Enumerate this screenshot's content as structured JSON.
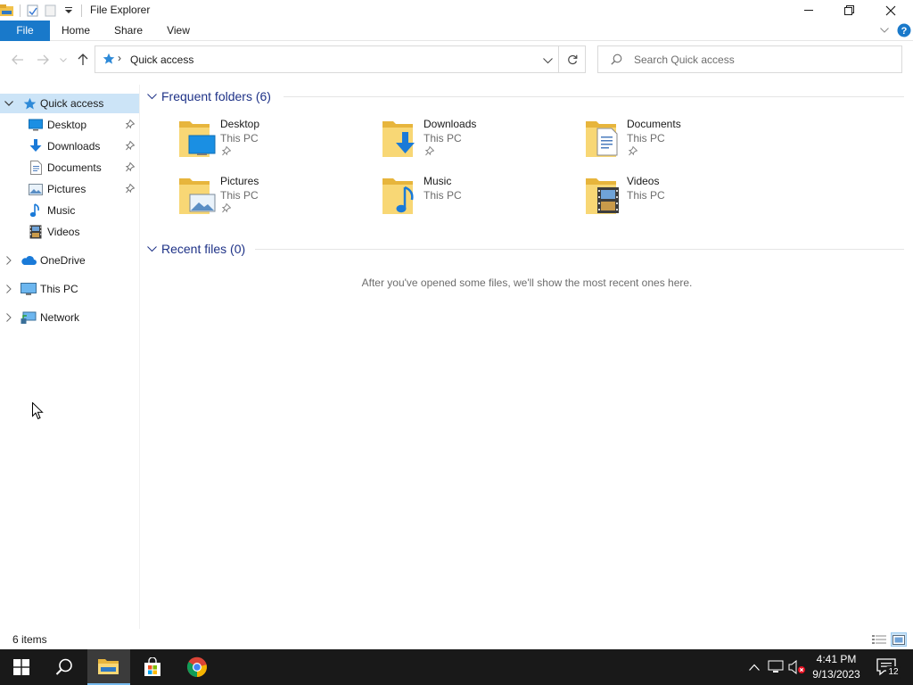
{
  "window": {
    "title": "File Explorer",
    "minimize_icon": "minimize-icon",
    "maximize_icon": "restore-icon",
    "close_icon": "close-icon"
  },
  "ribbon": {
    "tabs": [
      {
        "label": "File"
      },
      {
        "label": "Home"
      },
      {
        "label": "Share"
      },
      {
        "label": "View"
      }
    ],
    "accent": "#1979ca"
  },
  "address": {
    "location": "Quick access",
    "separator": "›"
  },
  "search": {
    "placeholder": "Search Quick access"
  },
  "navpane": {
    "items": [
      {
        "label": "Quick access",
        "icon": "star-icon",
        "selected": true
      },
      {
        "label": "Desktop",
        "icon": "desktop-icon",
        "pinned": true
      },
      {
        "label": "Downloads",
        "icon": "download-icon",
        "pinned": true
      },
      {
        "label": "Documents",
        "icon": "document-icon",
        "pinned": true
      },
      {
        "label": "Pictures",
        "icon": "picture-icon",
        "pinned": true
      },
      {
        "label": "Music",
        "icon": "music-icon"
      },
      {
        "label": "Videos",
        "icon": "video-icon"
      },
      {
        "label": "OneDrive",
        "icon": "cloud-icon"
      },
      {
        "label": "This PC",
        "icon": "computer-icon"
      },
      {
        "label": "Network",
        "icon": "network-icon"
      }
    ],
    "selected_bg": "#cce4f7"
  },
  "content": {
    "frequent_header": "Frequent folders (6)",
    "recent_header": "Recent files (0)",
    "folders": [
      {
        "name": "Desktop",
        "location": "This PC",
        "pinned": true
      },
      {
        "name": "Downloads",
        "location": "This PC",
        "pinned": true
      },
      {
        "name": "Documents",
        "location": "This PC",
        "pinned": true
      },
      {
        "name": "Pictures",
        "location": "This PC",
        "pinned": true
      },
      {
        "name": "Music",
        "location": "This PC",
        "pinned": false
      },
      {
        "name": "Videos",
        "location": "This PC",
        "pinned": false
      }
    ],
    "empty_message": "After you've opened some files, we'll show the most recent ones here.",
    "header_color": "#1e3287"
  },
  "statusbar": {
    "item_count": "6 items"
  },
  "taskbar": {
    "time": "4:41 PM",
    "date": "9/13/2023",
    "notification_count": "12",
    "background": "#191919"
  }
}
